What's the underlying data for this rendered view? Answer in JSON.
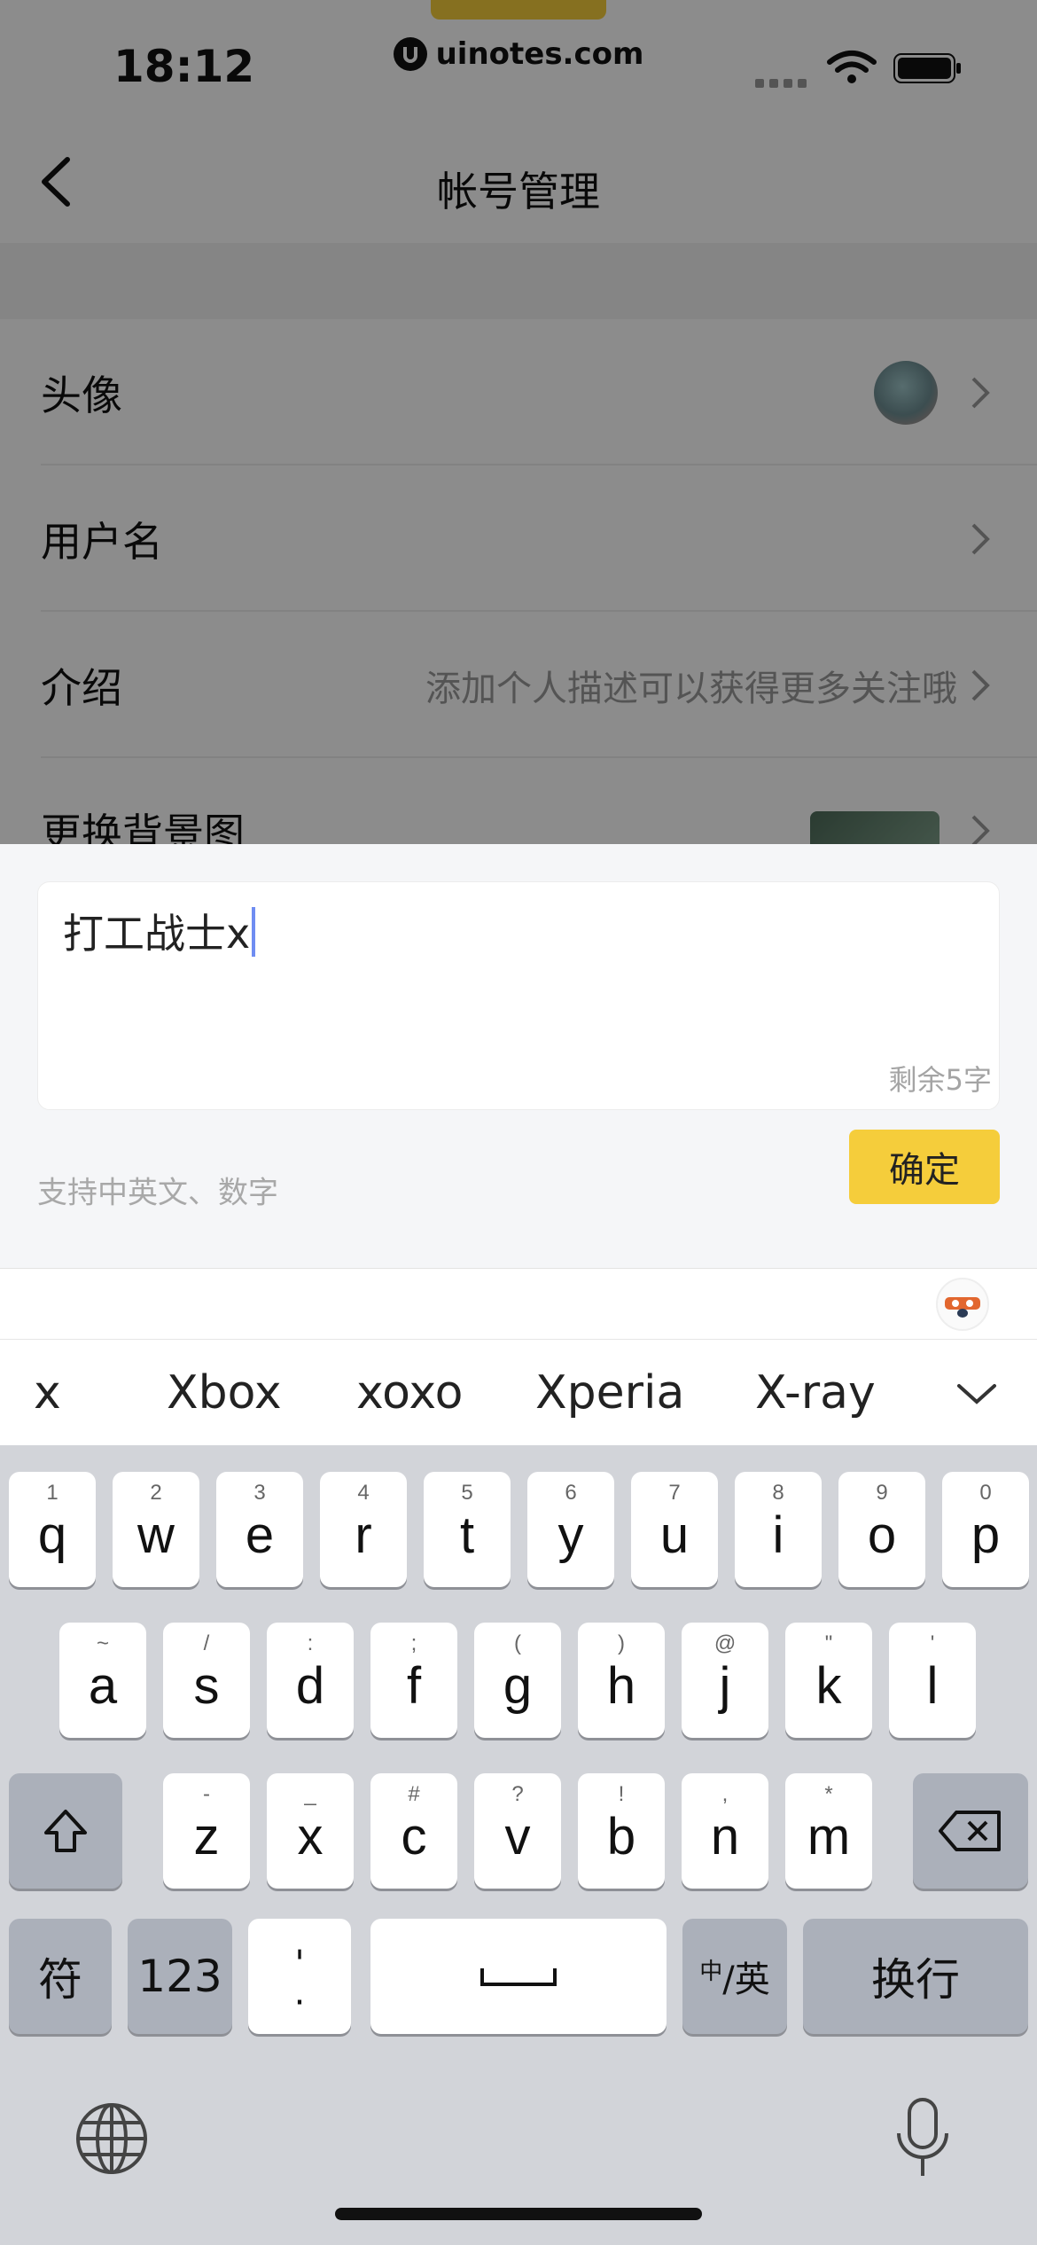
{
  "status_bar": {
    "time": "18:12"
  },
  "watermark": {
    "site": "uinotes.com"
  },
  "nav": {
    "title": "帐号管理"
  },
  "rows": [
    {
      "label": "头像"
    },
    {
      "label": "用户名"
    },
    {
      "label": "介绍",
      "value": "添加个人描述可以获得更多关注哦"
    },
    {
      "label": "更换背景图"
    }
  ],
  "editor": {
    "input_value": "打工战士x",
    "counter": "剩余5字",
    "hint": "支持中英文、数字",
    "confirm_label": "确定"
  },
  "suggestions": [
    "x",
    "Xbox",
    "xoxo",
    "Xperia",
    "X-ray"
  ],
  "keyboard": {
    "row1": [
      {
        "k": "q",
        "s": "1"
      },
      {
        "k": "w",
        "s": "2"
      },
      {
        "k": "e",
        "s": "3"
      },
      {
        "k": "r",
        "s": "4"
      },
      {
        "k": "t",
        "s": "5"
      },
      {
        "k": "y",
        "s": "6"
      },
      {
        "k": "u",
        "s": "7"
      },
      {
        "k": "i",
        "s": "8"
      },
      {
        "k": "o",
        "s": "9"
      },
      {
        "k": "p",
        "s": "0"
      }
    ],
    "row2": [
      {
        "k": "a",
        "s": "~"
      },
      {
        "k": "s",
        "s": "/"
      },
      {
        "k": "d",
        "s": ":"
      },
      {
        "k": "f",
        "s": ";"
      },
      {
        "k": "g",
        "s": "("
      },
      {
        "k": "h",
        "s": ")"
      },
      {
        "k": "j",
        "s": "@"
      },
      {
        "k": "k",
        "s": "\""
      },
      {
        "k": "l",
        "s": "'"
      }
    ],
    "row3": [
      {
        "k": "z",
        "s": "-"
      },
      {
        "k": "x",
        "s": "_"
      },
      {
        "k": "c",
        "s": "#"
      },
      {
        "k": "v",
        "s": "?"
      },
      {
        "k": "b",
        "s": "!"
      },
      {
        "k": "n",
        "s": ","
      },
      {
        "k": "m",
        "s": "*"
      }
    ],
    "symbols_label": "符",
    "numbers_label": "123",
    "punct_top": "'",
    "punct_bottom": ".",
    "lang_small": "中",
    "lang_big": "/英",
    "return_label": "换行"
  }
}
